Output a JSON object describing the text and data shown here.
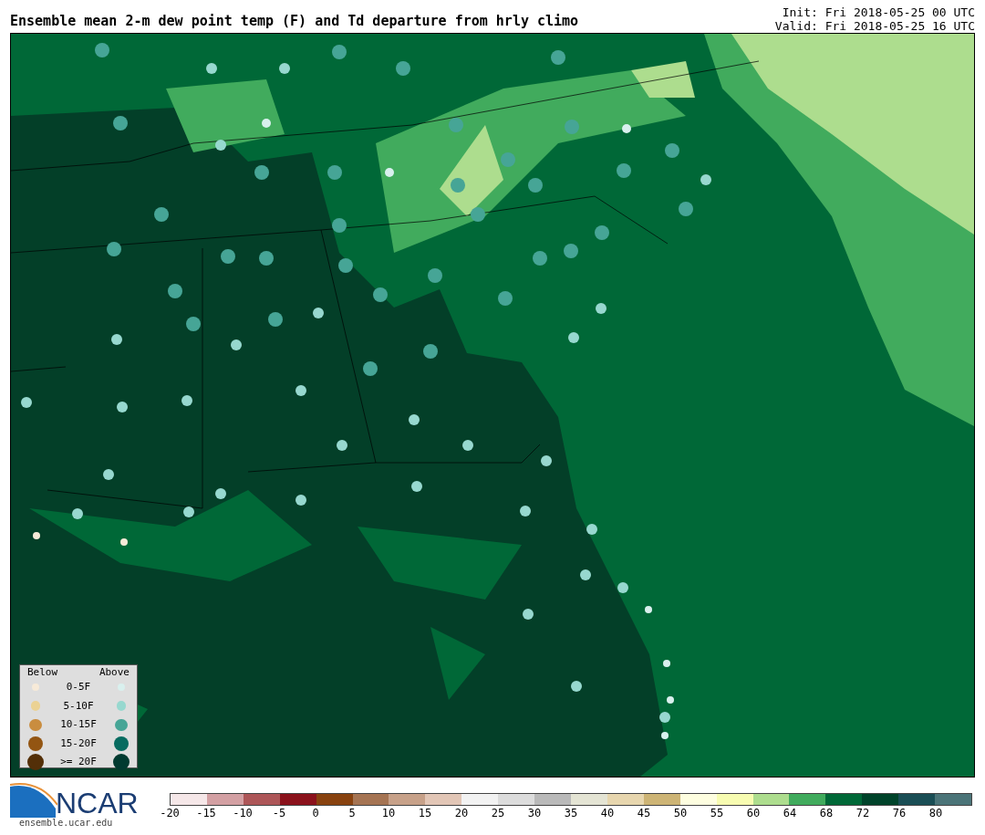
{
  "title": "Ensemble mean 2-m dew point temp (F) and Td departure from hrly climo",
  "init": "Init: Fri 2018-05-25 00 UTC",
  "valid": "Valid: Fri 2018-05-25 16 UTC",
  "legend": {
    "below_heading": "Below",
    "above_heading": "Above",
    "rows": [
      {
        "label": "0-5F",
        "below": {
          "color": "#f7ead8"
        },
        "above": {
          "color": "#d9f0ee"
        }
      },
      {
        "label": "5-10F",
        "below": {
          "color": "#ebd293"
        },
        "above": {
          "color": "#97d8cf"
        }
      },
      {
        "label": "10-15F",
        "below": {
          "color": "#c98d3f"
        },
        "above": {
          "color": "#46a596"
        }
      },
      {
        "label": "15-20F",
        "below": {
          "color": "#935512"
        },
        "above": {
          "color": "#076b60"
        }
      },
      {
        "label": ">= 20F",
        "below": {
          "color": "#532f08"
        },
        "above": {
          "color": "#003a30"
        }
      }
    ]
  },
  "logo": {
    "name": "NCAR",
    "url": "ensemble.ucar.edu"
  },
  "colorbar": {
    "segments": [
      {
        "color": "#f5e7e8"
      },
      {
        "color": "#d3a0a3"
      },
      {
        "color": "#ad5658"
      },
      {
        "color": "#8b121c"
      },
      {
        "color": "#88420f"
      },
      {
        "color": "#a57453"
      },
      {
        "color": "#c7a189"
      },
      {
        "color": "#e2c6b6"
      },
      {
        "color": "#f2f2f2"
      },
      {
        "color": "#dcdcdc"
      },
      {
        "color": "#b9b9b9"
      },
      {
        "color": "#e4e4d4"
      },
      {
        "color": "#e7d6ae"
      },
      {
        "color": "#cdb475"
      },
      {
        "color": "#fefee0"
      },
      {
        "color": "#f7fcb1"
      },
      {
        "color": "#addd8e"
      },
      {
        "color": "#41ab5d"
      },
      {
        "color": "#006837"
      },
      {
        "color": "#00432a"
      },
      {
        "color": "#1a4e55"
      },
      {
        "color": "#4b7478"
      }
    ],
    "ticks": [
      "-20",
      "-15",
      "-10",
      "-5",
      "0",
      "5",
      "10",
      "15",
      "20",
      "25",
      "30",
      "35",
      "40",
      "45",
      "50",
      "55",
      "60",
      "64",
      "68",
      "72",
      "76",
      "80"
    ]
  }
}
